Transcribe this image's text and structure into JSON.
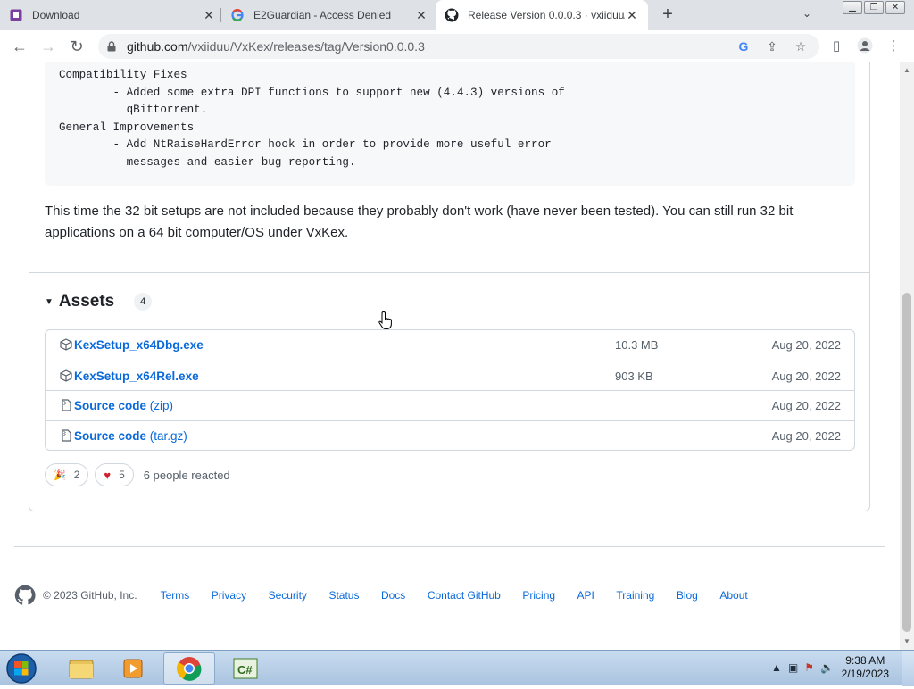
{
  "browser": {
    "tabs": [
      {
        "title": "Download",
        "icon": "download-site-icon"
      },
      {
        "title": "E2Guardian - Access Denied",
        "icon": "google-icon"
      },
      {
        "title": "Release Version 0.0.0.3 · vxiiduu/",
        "icon": "github-icon"
      }
    ],
    "url_host": "github.com",
    "url_path": "/vxiiduu/VxKex/releases/tag/Version0.0.0.3"
  },
  "release": {
    "code_text": "Compatibility Fixes\n        - Added some extra DPI functions to support new (4.4.3) versions of\n          qBittorrent.\nGeneral Improvements\n        - Add NtRaiseHardError hook in order to provide more useful error\n          messages and easier bug reporting.",
    "paragraph": "This time the 32 bit setups are not included because they probably don't work (have never been tested). You can still run 32 bit applications on a 64 bit computer/OS under VxKex.",
    "assets_label": "Assets",
    "assets_count": "4",
    "assets": [
      {
        "name": "KexSetup_x64Dbg.exe",
        "sub": "",
        "size": "10.3 MB",
        "date": "Aug 20, 2022",
        "icon": "package-icon"
      },
      {
        "name": "KexSetup_x64Rel.exe",
        "sub": "",
        "size": "903 KB",
        "date": "Aug 20, 2022",
        "icon": "package-icon"
      },
      {
        "name": "Source code",
        "sub": " (zip)",
        "size": "",
        "date": "Aug 20, 2022",
        "icon": "file-zip-icon"
      },
      {
        "name": "Source code",
        "sub": " (tar.gz)",
        "size": "",
        "date": "Aug 20, 2022",
        "icon": "file-zip-icon"
      }
    ],
    "reactions": [
      {
        "emoji": "🎉",
        "count": "2",
        "icon": "tada-icon"
      },
      {
        "emoji": "♥",
        "count": "5",
        "icon": "heart-icon"
      }
    ],
    "reacted_text": "6 people reacted"
  },
  "footer": {
    "copyright": "© 2023 GitHub, Inc.",
    "links": [
      "Terms",
      "Privacy",
      "Security",
      "Status",
      "Docs",
      "Contact GitHub",
      "Pricing",
      "API",
      "Training",
      "Blog",
      "About"
    ]
  },
  "taskbar": {
    "time": "9:38 AM",
    "date": "2/19/2023"
  },
  "colors": {
    "link": "#0969da",
    "border": "#d0d7de",
    "muted": "#57606a"
  }
}
